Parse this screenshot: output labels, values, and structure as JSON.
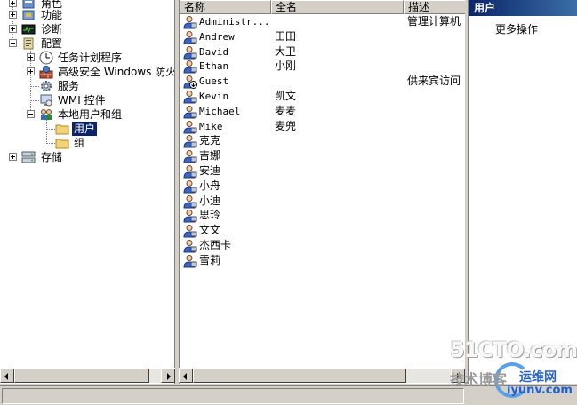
{
  "tree": {
    "items": [
      {
        "label": "角色",
        "icon": "roles-icon",
        "expander": "plus"
      },
      {
        "label": "功能",
        "icon": "features-icon",
        "expander": "plus"
      },
      {
        "label": "诊断",
        "icon": "diagnostics-icon",
        "expander": "plus"
      },
      {
        "label": "配置",
        "icon": "configuration-icon",
        "expander": "minus"
      },
      {
        "label": "任务计划程序",
        "icon": "clock-icon",
        "expander": "plus"
      },
      {
        "label": "高级安全 Windows 防火墙",
        "icon": "firewall-icon",
        "expander": "plus"
      },
      {
        "label": "服务",
        "icon": "gear-icon",
        "expander": ""
      },
      {
        "label": "WMI 控件",
        "icon": "wmi-icon",
        "expander": ""
      },
      {
        "label": "本地用户和组",
        "icon": "users-group-icon",
        "expander": "minus"
      },
      {
        "label": "用户",
        "icon": "folder-icon",
        "expander": "",
        "selected": true
      },
      {
        "label": "组",
        "icon": "folder-icon",
        "expander": ""
      },
      {
        "label": "存储",
        "icon": "storage-icon",
        "expander": "plus"
      }
    ]
  },
  "list": {
    "columns": [
      "名称",
      "全名",
      "描述"
    ],
    "rows": [
      {
        "name": "Administr...",
        "full": "",
        "desc": "管理计算机",
        "disabled": false
      },
      {
        "name": "Andrew",
        "full": "田田",
        "desc": "",
        "disabled": false
      },
      {
        "name": "David",
        "full": "大卫",
        "desc": "",
        "disabled": false
      },
      {
        "name": "Ethan",
        "full": "小刚",
        "desc": "",
        "disabled": false
      },
      {
        "name": "Guest",
        "full": "",
        "desc": "供来宾访问",
        "disabled": true
      },
      {
        "name": "Kevin",
        "full": "凯文",
        "desc": "",
        "disabled": false
      },
      {
        "name": "Michael",
        "full": "麦麦",
        "desc": "",
        "disabled": false
      },
      {
        "name": "Mike",
        "full": "麦兜",
        "desc": "",
        "disabled": false
      },
      {
        "name": "克克",
        "full": "",
        "desc": "",
        "disabled": false
      },
      {
        "name": "吉娜",
        "full": "",
        "desc": "",
        "disabled": false
      },
      {
        "name": "安迪",
        "full": "",
        "desc": "",
        "disabled": false
      },
      {
        "name": "小舟",
        "full": "",
        "desc": "",
        "disabled": false
      },
      {
        "name": "小迪",
        "full": "",
        "desc": "",
        "disabled": false
      },
      {
        "name": "思玲",
        "full": "",
        "desc": "",
        "disabled": false
      },
      {
        "name": "文文",
        "full": "",
        "desc": "",
        "disabled": false
      },
      {
        "name": "杰西卡",
        "full": "",
        "desc": "",
        "disabled": false
      },
      {
        "name": "雪莉",
        "full": "",
        "desc": "",
        "disabled": false
      }
    ]
  },
  "actions": {
    "title": "用户",
    "more": "更多操作"
  },
  "watermark": {
    "logo": "51CTO.com",
    "sub": "技术博客",
    "ops": "运维网",
    "url": "iyunv.com"
  },
  "colors": {
    "selection": "#0a246a",
    "action_title_start": "#0a246a",
    "action_title_end": "#3a6ea5"
  }
}
